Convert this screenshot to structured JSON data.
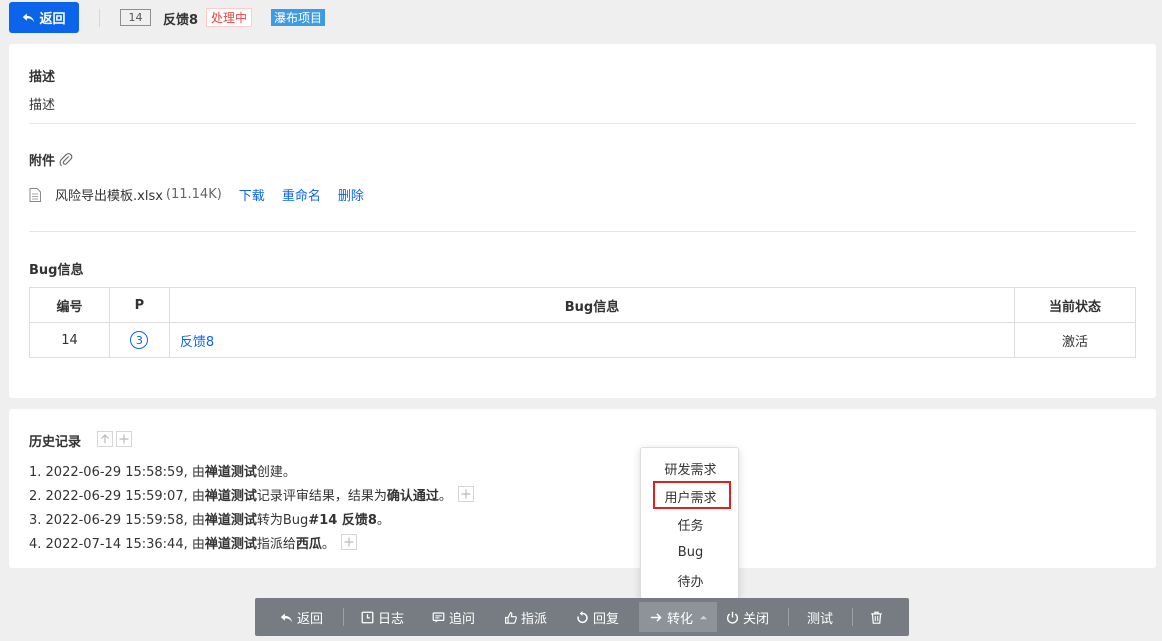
{
  "header": {
    "back_label": "返回",
    "id": "14",
    "title": "反馈8",
    "status": "处理中",
    "project": "瀑布项目"
  },
  "description": {
    "title": "描述",
    "content": "描述"
  },
  "attachments": {
    "title": "附件",
    "file_name": "风险导出模板.xlsx",
    "file_size": "(11.14K)",
    "download": "下载",
    "rename": "重命名",
    "delete": "删除"
  },
  "bug_info": {
    "title": "Bug信息",
    "columns": [
      "编号",
      "P",
      "Bug信息",
      "当前状态"
    ],
    "rows": [
      {
        "id": "14",
        "priority": "3",
        "name": "反馈8",
        "status": "激活"
      }
    ]
  },
  "history": {
    "title": "历史记录",
    "items": [
      {
        "prefix": "1. 2022-06-29 15:58:59, 由 ",
        "actor": "禅道测试",
        "text": " 创建。",
        "extra_bold": "",
        "suffix": ""
      },
      {
        "prefix": "2. 2022-06-29 15:59:07, 由 ",
        "actor": "禅道测试",
        "text": " 记录评审结果，结果为 ",
        "extra_bold": "确认通过",
        "suffix": "。"
      },
      {
        "prefix": "3. 2022-06-29 15:59:58, 由 ",
        "actor": "禅道测试",
        "text": " 转为Bug ",
        "extra_bold": "#14 反馈8",
        "suffix": " 。"
      },
      {
        "prefix": "4. 2022-07-14 15:36:44, 由 ",
        "actor": "禅道测试",
        "text": " 指派给 ",
        "extra_bold": "西瓜",
        "suffix": "。"
      }
    ]
  },
  "dropdown": {
    "items": [
      "研发需求",
      "用户需求",
      "任务",
      "Bug",
      "待办"
    ],
    "highlighted": "用户需求"
  },
  "toolbar": {
    "back": "返回",
    "log": "日志",
    "follow": "追问",
    "assign": "指派",
    "reply": "回复",
    "convert": "转化",
    "close": "关闭",
    "test": "测试"
  },
  "colors": {
    "primary": "#0c64eb",
    "status_red": "#e44444",
    "project_blue": "#3d9be6",
    "toolbar_bg": "#777c82",
    "highlight": "#e02020"
  }
}
